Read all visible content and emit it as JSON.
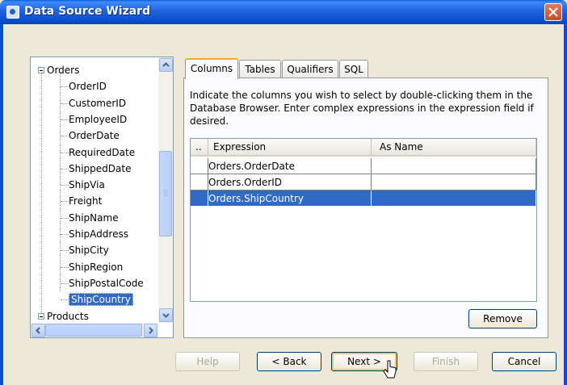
{
  "window": {
    "title": "Data Source Wizard"
  },
  "tree": {
    "items": [
      {
        "label": "Orders",
        "level": 0,
        "expanded": true
      },
      {
        "label": "OrderID",
        "level": 1
      },
      {
        "label": "CustomerID",
        "level": 1
      },
      {
        "label": "EmployeeID",
        "level": 1
      },
      {
        "label": "OrderDate",
        "level": 1
      },
      {
        "label": "RequiredDate",
        "level": 1
      },
      {
        "label": "ShippedDate",
        "level": 1
      },
      {
        "label": "ShipVia",
        "level": 1
      },
      {
        "label": "Freight",
        "level": 1
      },
      {
        "label": "ShipName",
        "level": 1
      },
      {
        "label": "ShipAddress",
        "level": 1
      },
      {
        "label": "ShipCity",
        "level": 1
      },
      {
        "label": "ShipRegion",
        "level": 1
      },
      {
        "label": "ShipPostalCode",
        "level": 1
      },
      {
        "label": "ShipCountry",
        "level": 1,
        "selected": true
      },
      {
        "label": "Products",
        "level": 0,
        "expanded": true
      }
    ]
  },
  "tabs": [
    {
      "label": "Columns",
      "active": true
    },
    {
      "label": "Tables"
    },
    {
      "label": "Qualifiers"
    },
    {
      "label": "SQL"
    }
  ],
  "columns_tab": {
    "description": "Indicate the columns you wish to select by double-clicking them in the Database Browser.  Enter complex expressions in the expression field if desired.",
    "table": {
      "headers": {
        "handle": "..",
        "expression": "Expression",
        "as_name": "As Name"
      },
      "rows": [
        {
          "expression": "Orders.OrderDate",
          "as_name": ""
        },
        {
          "expression": "Orders.OrderID",
          "as_name": ""
        },
        {
          "expression": "Orders.ShipCountry",
          "as_name": "",
          "selected": true
        }
      ]
    },
    "remove_label": "Remove"
  },
  "footer": {
    "help": "Help",
    "back": "< Back",
    "next": "Next >",
    "finish": "Finish",
    "cancel": "Cancel"
  },
  "colors": {
    "title_bar": "#2566e0",
    "selection": "#316ac5",
    "tab_highlight": "#f4a72a",
    "close": "#c94a26"
  }
}
